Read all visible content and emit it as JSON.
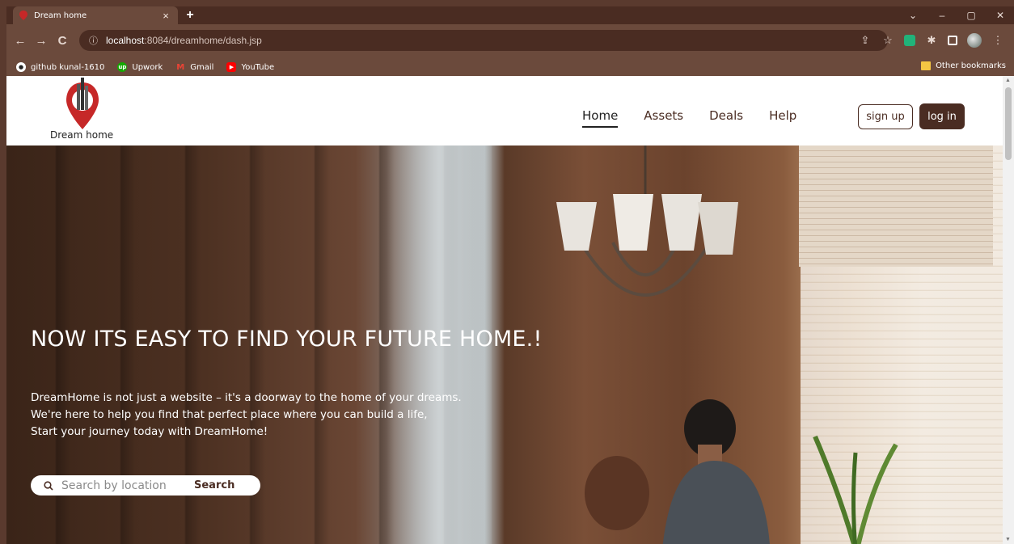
{
  "browser": {
    "tab_title": "Dream home",
    "url_host": "localhost",
    "url_path": ":8084/dreamhome/dash.jsp",
    "bookmarks": [
      {
        "label": "github kunal-1610",
        "icon": "github-icon"
      },
      {
        "label": "Upwork",
        "icon": "upwork-icon"
      },
      {
        "label": "Gmail",
        "icon": "gmail-icon"
      },
      {
        "label": "YouTube",
        "icon": "youtube-icon"
      }
    ],
    "other_bookmarks": "Other bookmarks"
  },
  "site": {
    "logo_text": "Dream home",
    "nav": [
      "Home",
      "Assets",
      "Deals",
      "Help"
    ],
    "signup_label": "sign up",
    "login_label": "log in"
  },
  "hero": {
    "title": "NOW ITS EASY TO FIND YOUR FUTURE HOME.!",
    "desc_line1": "DreamHome is not just a website – it's a doorway to the home of your dreams.",
    "desc_line2": "We're here to help you find that perfect place where you can build a life,",
    "desc_line3": "Start your journey today with DreamHome!",
    "search_placeholder": "Search by location",
    "search_button": "Search"
  },
  "colors": {
    "brand_brown": "#4a2c22",
    "chrome_brown": "#6b4a3c",
    "logo_red": "#c62828"
  }
}
